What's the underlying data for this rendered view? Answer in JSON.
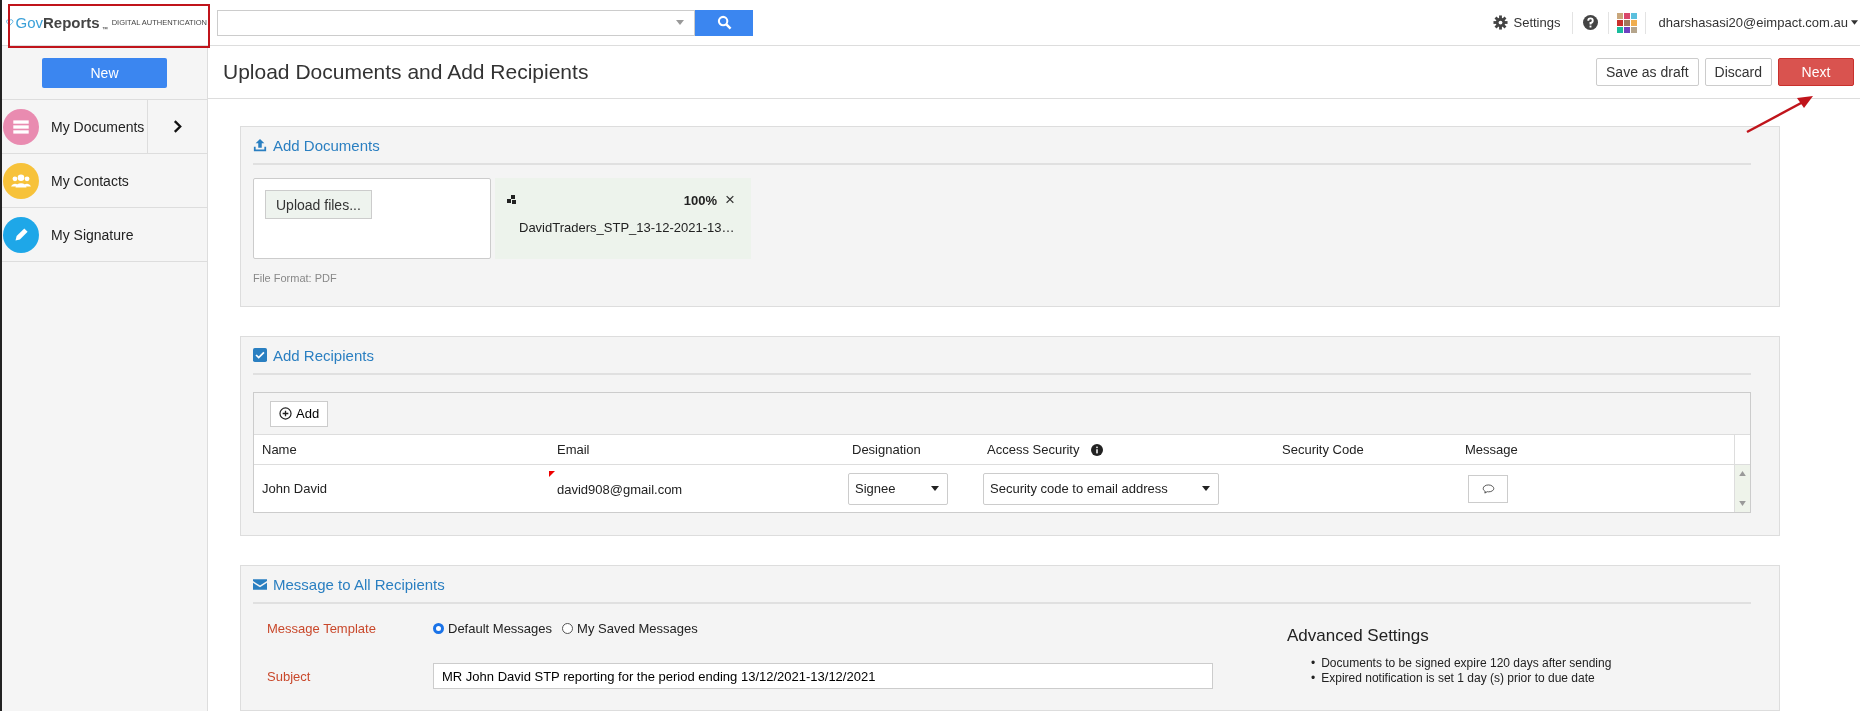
{
  "header": {
    "logo_brand": "GovReports",
    "logo_tm": "™",
    "logo_subtitle": "DIGITAL AUTHENTICATION",
    "settings": "Settings",
    "user": "dharshasasi20@eimpact.com.au"
  },
  "sidebar": {
    "new_button": "New",
    "items": [
      {
        "label": "My Documents",
        "color": "#e98bb0",
        "expandable": true
      },
      {
        "label": "My Contacts",
        "color": "#f7c23a",
        "expandable": false
      },
      {
        "label": "My Signature",
        "color": "#1ea7e8",
        "expandable": false
      }
    ]
  },
  "page": {
    "title": "Upload Documents and Add Recipients",
    "buttons": [
      {
        "label": "Save as draft",
        "kind": "default"
      },
      {
        "label": "Discard",
        "kind": "default"
      },
      {
        "label": "Next",
        "kind": "primary"
      }
    ]
  },
  "add_documents": {
    "title": "Add Documents",
    "upload_button": "Upload files...",
    "file": {
      "progress": "100%",
      "name": "DavidTraders_STP_13-12-2021-13…",
      "close": "×"
    },
    "format_note": "File Format: PDF"
  },
  "add_recipients": {
    "title": "Add Recipients",
    "add_button": "Add",
    "columns": [
      "Name",
      "Email",
      "Designation",
      "Access Security",
      "Security Code",
      "Message"
    ],
    "rows": [
      {
        "name": "John David",
        "email": "david908@gmail.com",
        "designation": "Signee",
        "access_security": "Security code to email address"
      }
    ]
  },
  "message": {
    "title": "Message to All Recipients",
    "template_label": "Message Template",
    "templates": [
      {
        "label": "Default Messages",
        "selected": true
      },
      {
        "label": "My Saved Messages",
        "selected": false
      }
    ],
    "subject_label": "Subject",
    "subject": "MR John David STP reporting for the period ending 13/12/2021-13/12/2021",
    "advanced": {
      "title": "Advanced Settings",
      "items": [
        {
          "marker": "•",
          "text": "Documents to be signed expire 120 days after sending"
        },
        {
          "marker": "•",
          "text": "Expired notification is set 1 day (s) prior to due date"
        }
      ]
    }
  }
}
